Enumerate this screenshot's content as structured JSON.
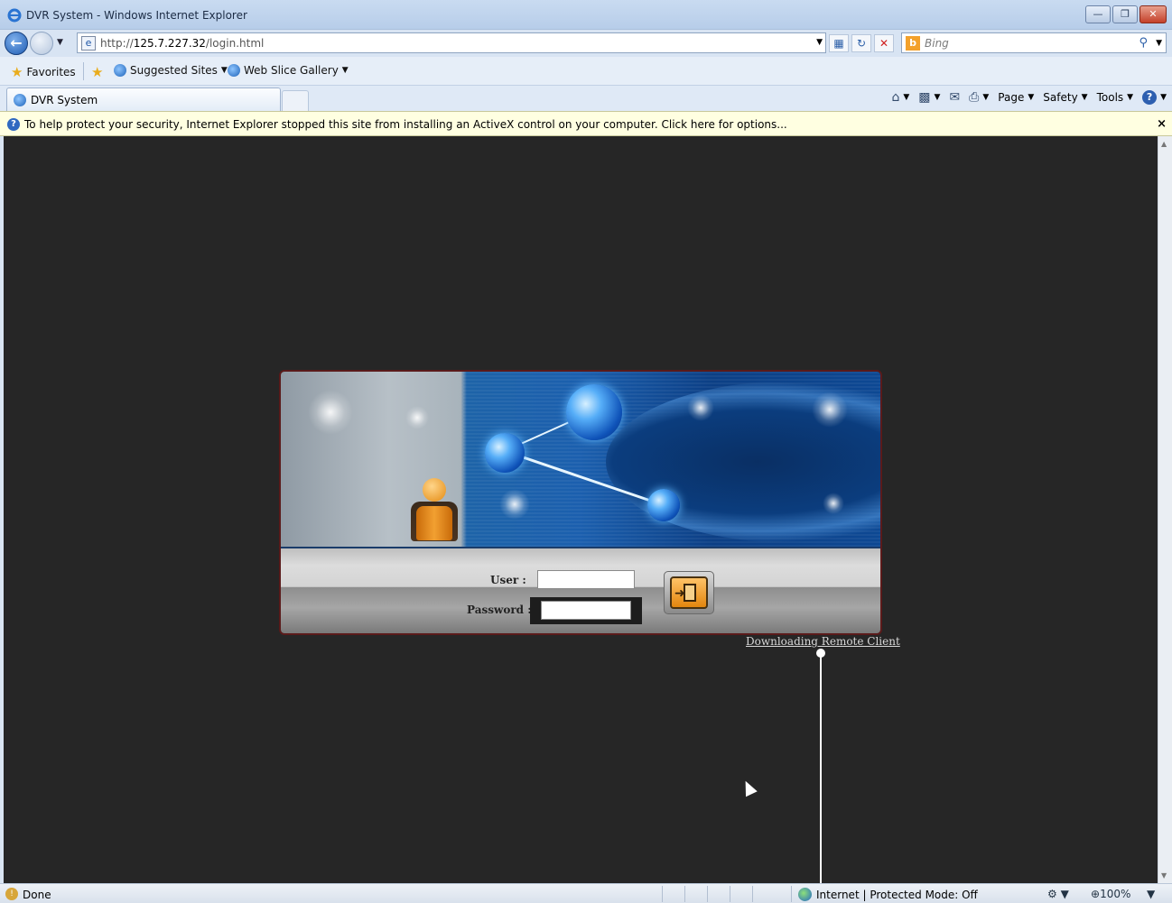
{
  "window": {
    "title": "DVR System - Windows Internet Explorer",
    "controls": [
      "minimize-icon",
      "restore-icon",
      "close-icon"
    ]
  },
  "address_bar": {
    "url_prefix": "http://",
    "url_host": "125.7.227.32",
    "url_path": "/login.html",
    "search_placeholder": "Bing"
  },
  "favorites_bar": {
    "favorites_label": "Favorites",
    "suggested_sites_label": "Suggested Sites",
    "web_slice_label": "Web Slice Gallery"
  },
  "tabs": [
    {
      "label": "DVR System",
      "active": true
    }
  ],
  "command_bar": {
    "page_label": "Page",
    "safety_label": "Safety",
    "tools_label": "Tools"
  },
  "info_bar": {
    "message": "To help protect your security, Internet Explorer stopped this site from installing an ActiveX control on your computer. Click here for options...",
    "close_glyph": "×"
  },
  "login": {
    "user_label": "User :",
    "password_label": "Password :",
    "user_value": "",
    "password_value": "",
    "download_link": "Downloading Remote Client"
  },
  "status_bar": {
    "status_text": "Done",
    "zone_text": "Internet | Protected Mode: Off",
    "zoom_text": "100%"
  },
  "colors": {
    "page_background": "#262626",
    "info_bar": "#ffffe1",
    "login_button": "#e3860e"
  }
}
